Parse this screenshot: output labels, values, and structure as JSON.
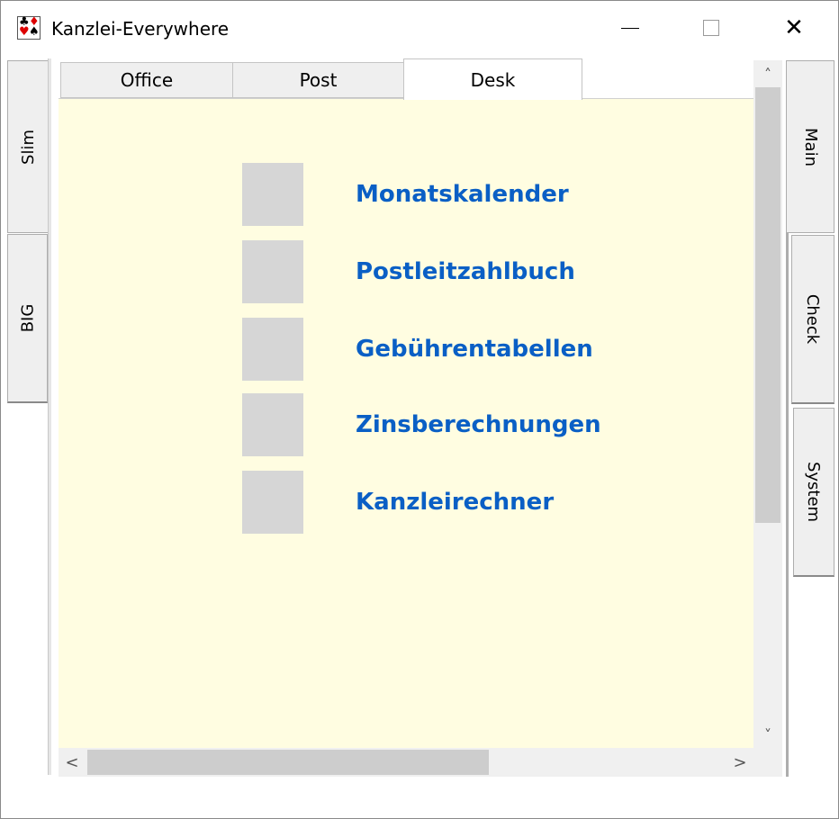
{
  "window": {
    "title": "Kanzlei-Everywhere",
    "icon": "card-suits-icon",
    "controls": {
      "minimize": "minimize-icon",
      "maximize": "maximize-icon",
      "close": "✕"
    }
  },
  "left_tabs": [
    {
      "label": "Slim"
    },
    {
      "label": "BIG"
    }
  ],
  "right_tabs": [
    {
      "label": "Main"
    },
    {
      "label": "Check"
    },
    {
      "label": "System"
    }
  ],
  "top_tabs": [
    {
      "label": "Office",
      "selected": false
    },
    {
      "label": "Post",
      "selected": false
    },
    {
      "label": "Desk",
      "selected": true
    }
  ],
  "desk_items": [
    {
      "label": "Monatskalender"
    },
    {
      "label": "Postleitzahlbuch"
    },
    {
      "label": "Gebührentabellen"
    },
    {
      "label": "Zinsberechnungen"
    },
    {
      "label": "Kanzleirechner"
    }
  ],
  "colors": {
    "panel_bg": "#fffde1",
    "link": "#0a5fc5",
    "thumb": "#d6d6d6"
  },
  "scrollbars": {
    "vertical": {
      "up": "˄",
      "down": "˅"
    },
    "horizontal": {
      "left": "<",
      "right": ">"
    }
  }
}
